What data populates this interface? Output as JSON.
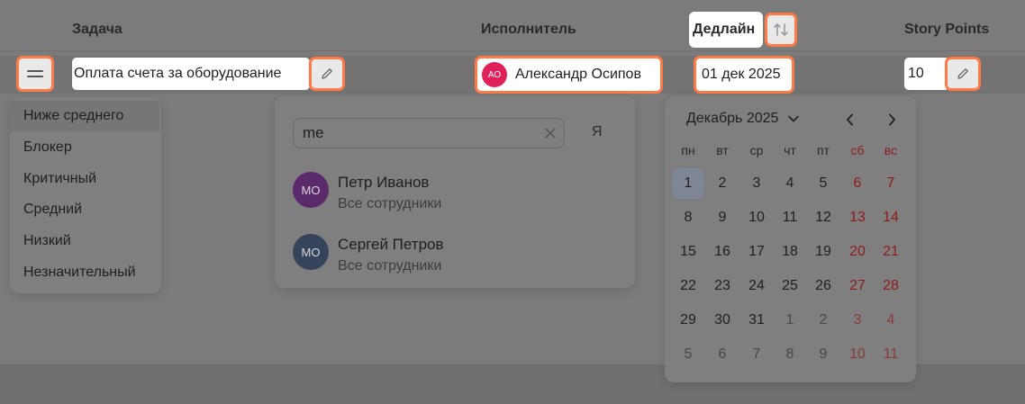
{
  "header": {
    "task": "Задача",
    "assignee": "Исполнитель",
    "deadline": "Дедлайн",
    "story_points": "Story Points"
  },
  "row": {
    "task_title": "Оплата счета за оборудование",
    "assignee_initials": "АО",
    "assignee_name": "Александр Осипов",
    "deadline": "01 дек 2025",
    "story_points": "10"
  },
  "priority_menu": {
    "items": [
      "Ниже среднего",
      "Блокер",
      "Критичный",
      "Средний",
      "Низкий",
      "Незначительный"
    ],
    "selected": "Ниже среднего"
  },
  "assignee_picker": {
    "search_value": "me",
    "self_label": "Я",
    "users": [
      {
        "initials": "МО",
        "name": "Петр Иванов",
        "group": "Все сотрудники",
        "color": "#5a2a6a"
      },
      {
        "initials": "МО",
        "name": "Сергей Петров",
        "group": "Все сотрудники",
        "color": "#35445a"
      }
    ]
  },
  "calendar": {
    "month_label": "Декабрь 2025",
    "weekdays": [
      "пн",
      "вт",
      "ср",
      "чт",
      "пт",
      "сб",
      "вс"
    ],
    "weeks": [
      [
        "1",
        "2",
        "3",
        "4",
        "5",
        "6",
        "7"
      ],
      [
        "8",
        "9",
        "10",
        "11",
        "12",
        "13",
        "14"
      ],
      [
        "15",
        "16",
        "17",
        "18",
        "19",
        "20",
        "21"
      ],
      [
        "22",
        "23",
        "24",
        "25",
        "26",
        "27",
        "28"
      ],
      [
        "29",
        "30",
        "31",
        "1",
        "2",
        "3",
        "4"
      ],
      [
        "5",
        "6",
        "7",
        "8",
        "9",
        "10",
        "11"
      ]
    ],
    "selected_day": "1"
  },
  "colors": {
    "highlight": "#ff7a45",
    "assignee_avatar": "#e0205a"
  }
}
